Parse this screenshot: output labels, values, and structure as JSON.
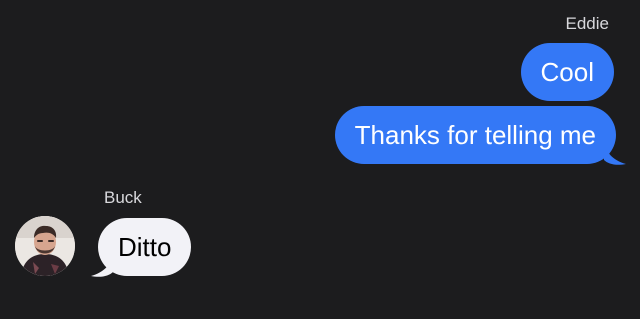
{
  "conversation": {
    "outgoing": {
      "sender": "Eddie",
      "messages": [
        {
          "text": "Cool"
        },
        {
          "text": "Thanks for telling me"
        }
      ]
    },
    "incoming": {
      "sender": "Buck",
      "messages": [
        {
          "text": "Ditto"
        }
      ],
      "avatar_icon": "person-photo-avatar"
    }
  },
  "colors": {
    "background": "#1c1c1e",
    "outgoing_bubble": "#3478f6",
    "incoming_bubble": "#f2f2f7",
    "sender_name": "#d8d8dc"
  }
}
